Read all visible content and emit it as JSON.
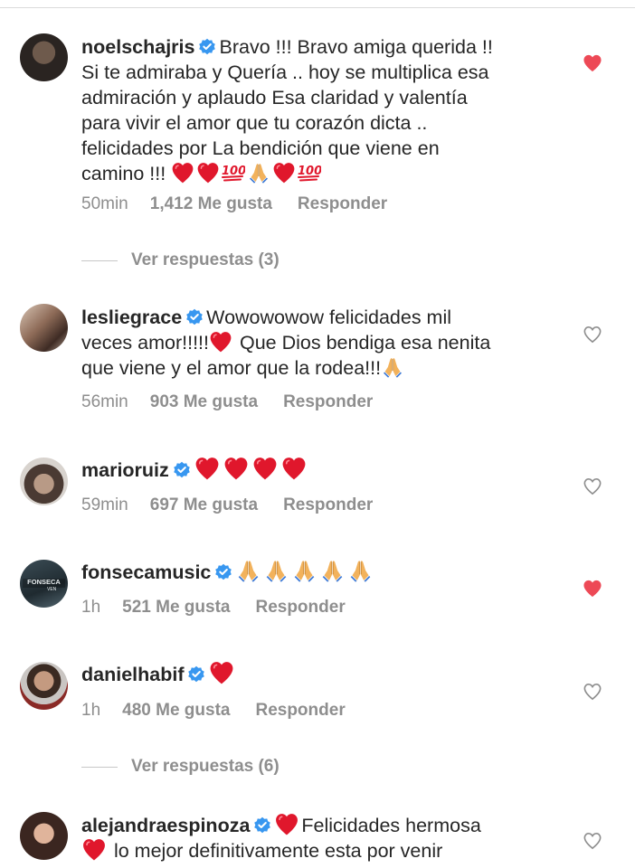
{
  "comments": [
    {
      "username": "noelschajris",
      "text1": "Bravo !!! Bravo amiga querida !! ",
      "lines": [
        "Si te admiraba y Quería .. hoy se multiplica esa",
        "admiración y aplaudo Esa claridad y valentía",
        "para vivir el amor que tu corazón dicta ..",
        "felicidades por La bendición que viene en"
      ],
      "last_text": "camino !!! ",
      "time": "50min",
      "likes": "1,412 Me gusta",
      "reply": "Responder",
      "liked": true,
      "emojis": [
        "red-heart",
        "red-heart",
        "hundred-points",
        "folded-hands",
        "red-heart",
        "hundred-points"
      ]
    },
    {
      "username": "lesliegrace",
      "text1": "Wowowowow felicidades mil",
      "text2": "veces amor!!!!!",
      "text3": " Que Dios bendiga esa nenita",
      "text4": "que viene y el amor que la rodea!!!",
      "time": "56min",
      "likes": "903 Me gusta",
      "reply": "Responder",
      "liked": false
    },
    {
      "username": "marioruiz",
      "time": "59min",
      "likes": "697 Me gusta",
      "reply": "Responder",
      "liked": false,
      "emojis": [
        "red-heart",
        "red-heart",
        "red-heart",
        "red-heart"
      ]
    },
    {
      "username": "fonsecamusic",
      "time": "1h",
      "likes": "521 Me gusta",
      "reply": "Responder",
      "liked": true,
      "emojis": [
        "folded-hands",
        "folded-hands",
        "folded-hands",
        "folded-hands",
        "folded-hands"
      ]
    },
    {
      "username": "danielhabif",
      "time": "1h",
      "likes": "480 Me gusta",
      "reply": "Responder",
      "liked": false,
      "emojis": [
        "red-heart"
      ]
    },
    {
      "username": "alejandraespinoza",
      "text1": "Felicidades hermosa",
      "text2": " lo mejor definitivamente esta por venir",
      "liked": false
    }
  ],
  "view_replies_1": "Ver respuestas (3)",
  "view_replies_2": "Ver respuestas (6)",
  "colors": {
    "liked_heart": "#ed4956",
    "verified_badge": "#3897f0",
    "muted_text": "#8e8e8e"
  }
}
